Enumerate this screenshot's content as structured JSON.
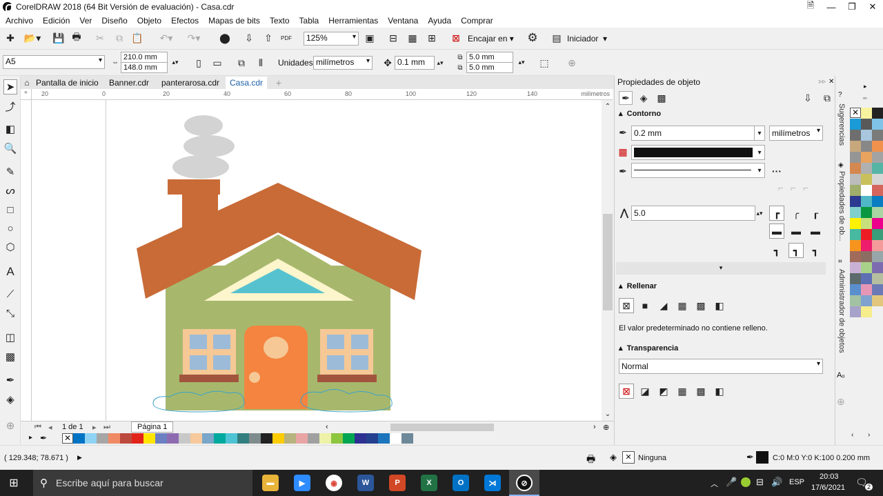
{
  "window": {
    "title": "CorelDRAW 2018 (64 Bit Versión de evaluación) - Casa.cdr"
  },
  "menu": [
    "Archivo",
    "Edición",
    "Ver",
    "Diseño",
    "Objeto",
    "Efectos",
    "Mapas de bits",
    "Texto",
    "Tabla",
    "Herramientas",
    "Ventana",
    "Ayuda",
    "Comprar"
  ],
  "toolbar": {
    "zoom": "125%",
    "fit_label": "Encajar en",
    "launcher_label": "Iniciador"
  },
  "propbar": {
    "page_size": "A5",
    "width": "210.0 mm",
    "height": "148.0 mm",
    "units_label": "Unidades:",
    "units": "milímetros",
    "nudge": "0.1 mm",
    "dup_x": "5.0 mm",
    "dup_y": "5.0 mm"
  },
  "doc_tabs": [
    {
      "label": "Pantalla de inicio"
    },
    {
      "label": "Banner.cdr"
    },
    {
      "label": "panterarosa.cdr"
    },
    {
      "label": "Casa.cdr",
      "active": true
    }
  ],
  "ruler": {
    "ticks": [
      "20",
      "0",
      "20",
      "40",
      "60",
      "80",
      "100",
      "120",
      "140"
    ],
    "unit": "milímetros"
  },
  "pager": {
    "page_of": "1  de  1",
    "page_tab": "Página 1"
  },
  "status": {
    "coords": "( 129.348; 78.671 )",
    "fill": "Ninguna",
    "outline": "C:0 M:0 Y:0 K:100  0.200 mm"
  },
  "panel": {
    "title": "Propiedades de objeto",
    "outline_title": "Contorno",
    "outline_width": "0.2 mm",
    "outline_units": "milímetros",
    "miter": "5.0",
    "fill_title": "Rellenar",
    "fill_msg": "El valor predeterminado no contiene relleno.",
    "transp_title": "Transparencia",
    "transp_mode": "Normal"
  },
  "sidetabs": [
    "Sugerencias",
    "Propiedades de ob...",
    "Administrador de objetos"
  ],
  "taskbar": {
    "search": "Escribe aquí para buscar",
    "time": "20:03",
    "date": "17/6/2021",
    "lang": "ESP",
    "notif": "2"
  },
  "colors": {
    "roof": "#c86b37",
    "wall": "#a7b86d",
    "door": "#f4843f",
    "window_frame": "#f5c896",
    "glass": "#9cbbd8",
    "sill": "#a2553d",
    "tri_outer": "#fdf5cc",
    "tri_inner": "#56c2cf",
    "smoke": "#d3d3d3"
  },
  "palette_h": [
    "#0073c5",
    "#8fd3f4",
    "#a6a6a6",
    "#f08a64",
    "#bd4a3e",
    "#e2231a",
    "#ffe500",
    "#6c7fc2",
    "#8d6bb0",
    "#c8c8c8",
    "#f7c99d",
    "#7aa6c9",
    "#00a99d",
    "#4ec3d4",
    "#337f80",
    "#7f8c8d",
    "#222222",
    "#ffcc00",
    "#b7b37e",
    "#e9a4a4",
    "#a0a0a0",
    "#eef2a8",
    "#8dc63f",
    "#00a651",
    "#2e3192",
    "#25408f",
    "#1c75bc",
    "#ffffff",
    "#6d8899"
  ],
  "palette_v": [
    "#ffffff",
    "#f7f4a0",
    "#222222",
    "#1a9ad6",
    "#595959",
    "#7fc4e8",
    "#6e6e6e",
    "#a8c6de",
    "#7a7a7a",
    "#c7a87c",
    "#888888",
    "#f0924e",
    "#959595",
    "#e8a35f",
    "#a3a3a3",
    "#d4884f",
    "#b0b0b0",
    "#56b4a5",
    "#bcbcbc",
    "#c8c05a",
    "#d6d6d6",
    "#9fae6b",
    "#ffffff",
    "#d6655b",
    "#2b3990",
    "#4fb7c5",
    "#0a7cc1",
    "#7fd0cd",
    "#0b9640",
    "#a8d5a2",
    "#fff200",
    "#c6e07c",
    "#ec008c",
    "#47b9a1",
    "#ed1c24",
    "#3a9d7a",
    "#f7941d",
    "#ed1c6d",
    "#f49a9a",
    "#a16b5c",
    "#8c6d62",
    "#97a6a8",
    "#c9b1d6",
    "#a8d28a",
    "#7d6bb0",
    "#5d6a6b",
    "#5e6fb4",
    "#b5bfa0",
    "#5a8fce",
    "#e896b6",
    "#6b7ab6",
    "#a2c2a3",
    "#7fa2cf",
    "#e2c67c",
    "#a7a2c9",
    "#f6ed8b"
  ]
}
